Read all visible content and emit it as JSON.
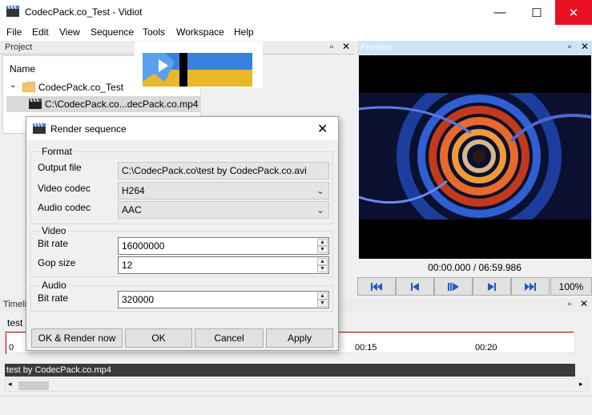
{
  "window": {
    "title": "CodecPack.co_Test - Vidiot",
    "minimize_glyph": "—",
    "maximize_glyph": "☐",
    "close_glyph": "✕"
  },
  "menu": [
    "File",
    "Edit",
    "View",
    "Sequence",
    "Tools",
    "Workspace",
    "Help"
  ],
  "project": {
    "panel_title": "Project",
    "column_name": "Name",
    "folder": "CodecPack.co_Test",
    "file": "C:\\CodecPack.co...decPack.co.mp4"
  },
  "preview": {
    "panel_title": "Preview",
    "timecode": "00:00.000 / 06:59.986",
    "zoom": "100%",
    "transport_icons": [
      "skip-to-start-icon",
      "step-back-icon",
      "play-icon",
      "step-forward-icon",
      "skip-to-end-icon"
    ]
  },
  "timeline": {
    "panel_title": "Timeline",
    "tab": "test",
    "ruler": [
      "0",
      "00:15",
      "00:20"
    ],
    "track_clip": "test by CodecPack.co.mp4"
  },
  "dialog": {
    "title": "Render sequence",
    "format_group": "Format",
    "output_file_label": "Output file",
    "output_file_value": "C:\\CodecPack.co\\test by CodecPack.co.avi",
    "video_codec_label": "Video codec",
    "video_codec_value": "H264",
    "audio_codec_label": "Audio codec",
    "audio_codec_value": "AAC",
    "video_group": "Video",
    "video_bitrate_label": "Bit rate",
    "video_bitrate_value": "16000000",
    "gop_label": "Gop size",
    "gop_value": "12",
    "audio_group": "Audio",
    "audio_bitrate_label": "Bit rate",
    "audio_bitrate_value": "320000",
    "buttons": {
      "render_now": "OK & Render now",
      "ok": "OK",
      "cancel": "Cancel",
      "apply": "Apply"
    }
  },
  "colors": {
    "preview_header": "#cce4f7",
    "close_hover": "#e81123",
    "logo_blue": "#3b7fe0",
    "logo_yellow": "#e8b82a"
  }
}
